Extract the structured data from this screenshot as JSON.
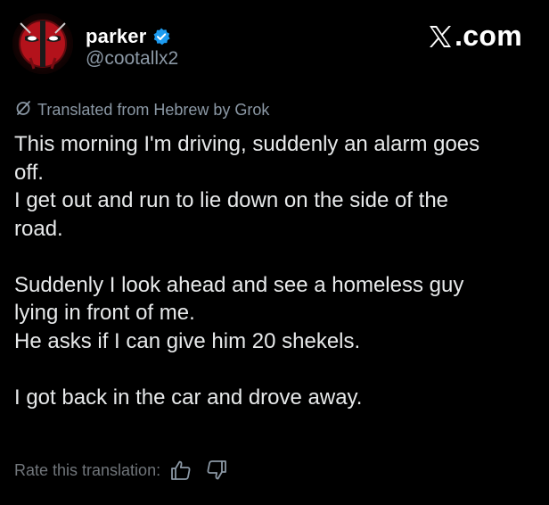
{
  "author": {
    "display_name": "parker",
    "handle": "@cootallx2",
    "verified_icon": "verified-badge-icon",
    "avatar_icon": "deadpool-avatar-icon"
  },
  "brand": {
    "label": ".com",
    "icon": "x-logo-icon"
  },
  "translation": {
    "notice": "Translated from Hebrew by Grok",
    "icon": "translate-slash-icon"
  },
  "post": {
    "lines": [
      "This morning I'm driving, suddenly an alarm goes",
      "off.",
      "I get out and run to lie down on the side of the",
      "road.",
      "",
      "Suddenly I look ahead and see a homeless guy",
      "lying in front of me.",
      "He asks if I can give him 20 shekels.",
      "",
      "I got back in the car and drove away."
    ]
  },
  "rating": {
    "label": "Rate this translation:",
    "thumbs_up_icon": "thumbs-up-icon",
    "thumbs_down_icon": "thumbs-down-icon"
  },
  "colors": {
    "background": "#000000",
    "text_primary": "#e7e9ea",
    "text_secondary": "#8b98a5",
    "verified_blue": "#1d9bf0"
  }
}
